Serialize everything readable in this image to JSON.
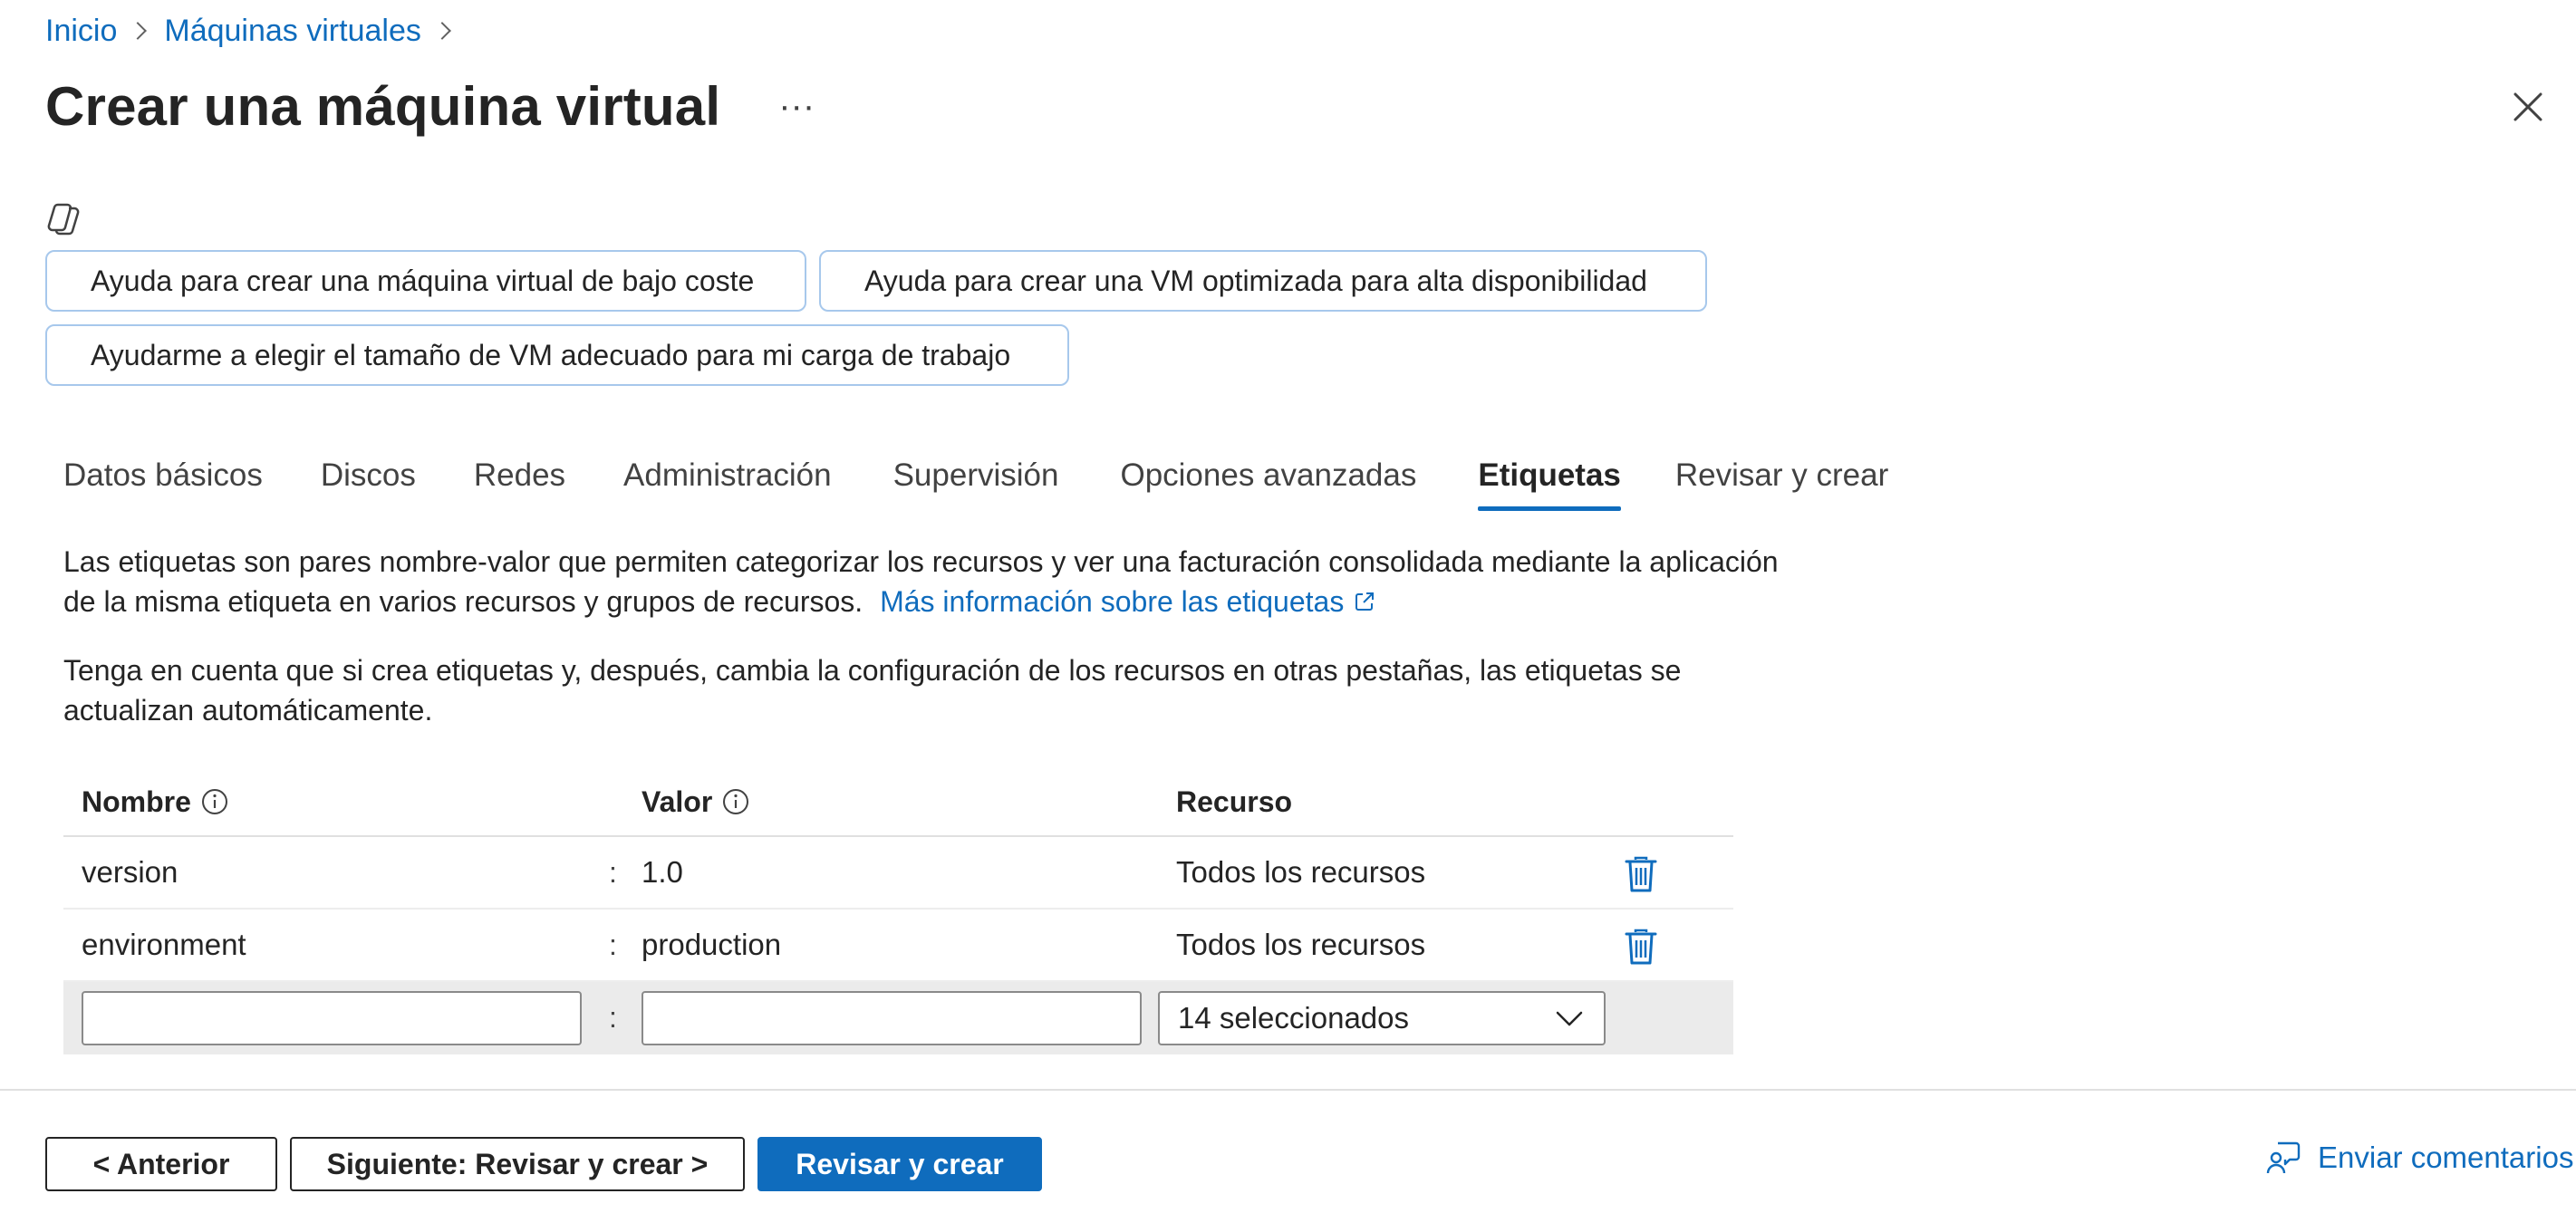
{
  "breadcrumb": {
    "items": [
      "Inicio",
      "Máquinas virtuales"
    ]
  },
  "header": {
    "title": "Crear una máquina virtual",
    "more": "···"
  },
  "suggestions": [
    "Ayuda para crear una máquina virtual de bajo coste",
    "Ayuda para crear una VM optimizada para alta disponibilidad",
    "Ayudarme a elegir el tamaño de VM adecuado para mi carga de trabajo"
  ],
  "tabs": [
    {
      "label": "Datos básicos",
      "active": false
    },
    {
      "label": "Discos",
      "active": false
    },
    {
      "label": "Redes",
      "active": false
    },
    {
      "label": "Administración",
      "active": false
    },
    {
      "label": "Supervisión",
      "active": false
    },
    {
      "label": "Opciones avanzadas",
      "active": false
    },
    {
      "label": "Etiquetas",
      "active": true
    },
    {
      "label": "Revisar y crear",
      "active": false
    }
  ],
  "description": {
    "paragraph1": "Las etiquetas son pares nombre-valor que permiten categorizar los recursos y ver una facturación consolidada mediante la aplicación de la misma etiqueta en varios recursos y grupos de recursos.",
    "learn_more_link": "Más información sobre las etiquetas",
    "paragraph2": "Tenga en cuenta que si crea etiquetas y, después, cambia la configuración de los recursos en otras pestañas, las etiquetas se actualizan automáticamente."
  },
  "table": {
    "headers": {
      "name": "Nombre",
      "value": "Valor",
      "resource": "Recurso"
    },
    "separator": ":",
    "rows": [
      {
        "name": "version",
        "value": "1.0",
        "resource": "Todos los recursos"
      },
      {
        "name": "environment",
        "value": "production",
        "resource": "Todos los recursos"
      }
    ],
    "new_row": {
      "name_value": "",
      "value_value": "",
      "resource_selected": "14 seleccionados"
    }
  },
  "footer": {
    "previous": "< Anterior",
    "next": "Siguiente: Revisar y crear >",
    "review_create": "Revisar y crear",
    "feedback": "Enviar comentarios"
  },
  "colors": {
    "accent": "#0f6cbd",
    "text": "#242424",
    "chip_border": "#a7c8ec"
  }
}
